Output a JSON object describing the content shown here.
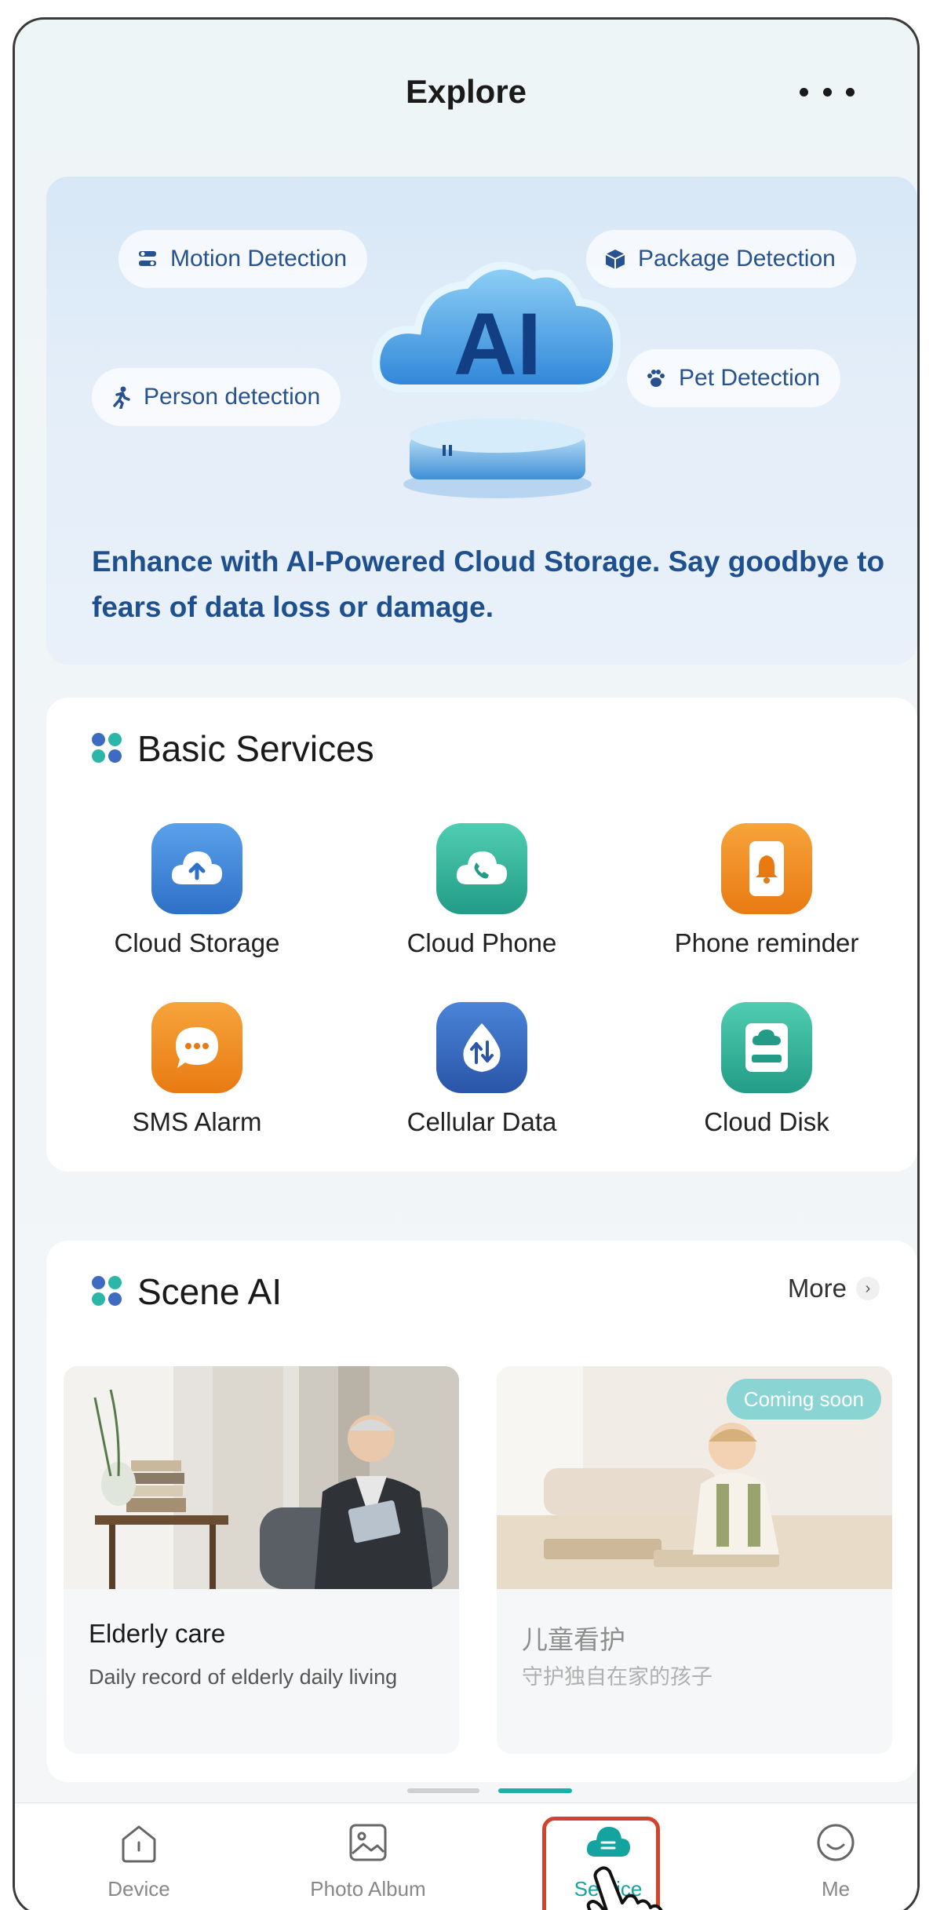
{
  "header": {
    "title": "Explore"
  },
  "banner": {
    "pills": {
      "motion": "Motion Detection",
      "package": "Package Detection",
      "person": "Person detection",
      "pet": "Pet Detection"
    },
    "logo_text": "AI",
    "description": "Enhance with AI-Powered Cloud Storage. Say goodbye to fears of data loss or damage."
  },
  "basic_services": {
    "title": "Basic Services",
    "items": [
      {
        "label": "Cloud Storage",
        "icon": "cloud-upload-icon",
        "color": "#3f86d6"
      },
      {
        "label": "Cloud Phone",
        "icon": "phone-cloud-icon",
        "color": "#2fb59c"
      },
      {
        "label": "Phone reminder",
        "icon": "bell-phone-icon",
        "color": "#f08d1f"
      },
      {
        "label": "SMS Alarm",
        "icon": "sms-bubble-icon",
        "color": "#f08d1f"
      },
      {
        "label": "Cellular Data",
        "icon": "data-arrows-icon",
        "color": "#3a6fc4"
      },
      {
        "label": "Cloud Disk",
        "icon": "disk-icon",
        "color": "#2fb59c"
      }
    ]
  },
  "scene_ai": {
    "title": "Scene AI",
    "more_label": "More",
    "cards": [
      {
        "title": "Elderly care",
        "desc": "Daily record of elderly daily living",
        "badge": ""
      },
      {
        "title": "儿童看护",
        "desc": "守护独自在家的孩子",
        "badge": "Coming soon"
      }
    ]
  },
  "tabbar": {
    "device": "Device",
    "album": "Photo Album",
    "service": "Service",
    "me": "Me",
    "active_color": "#15a3a0"
  }
}
